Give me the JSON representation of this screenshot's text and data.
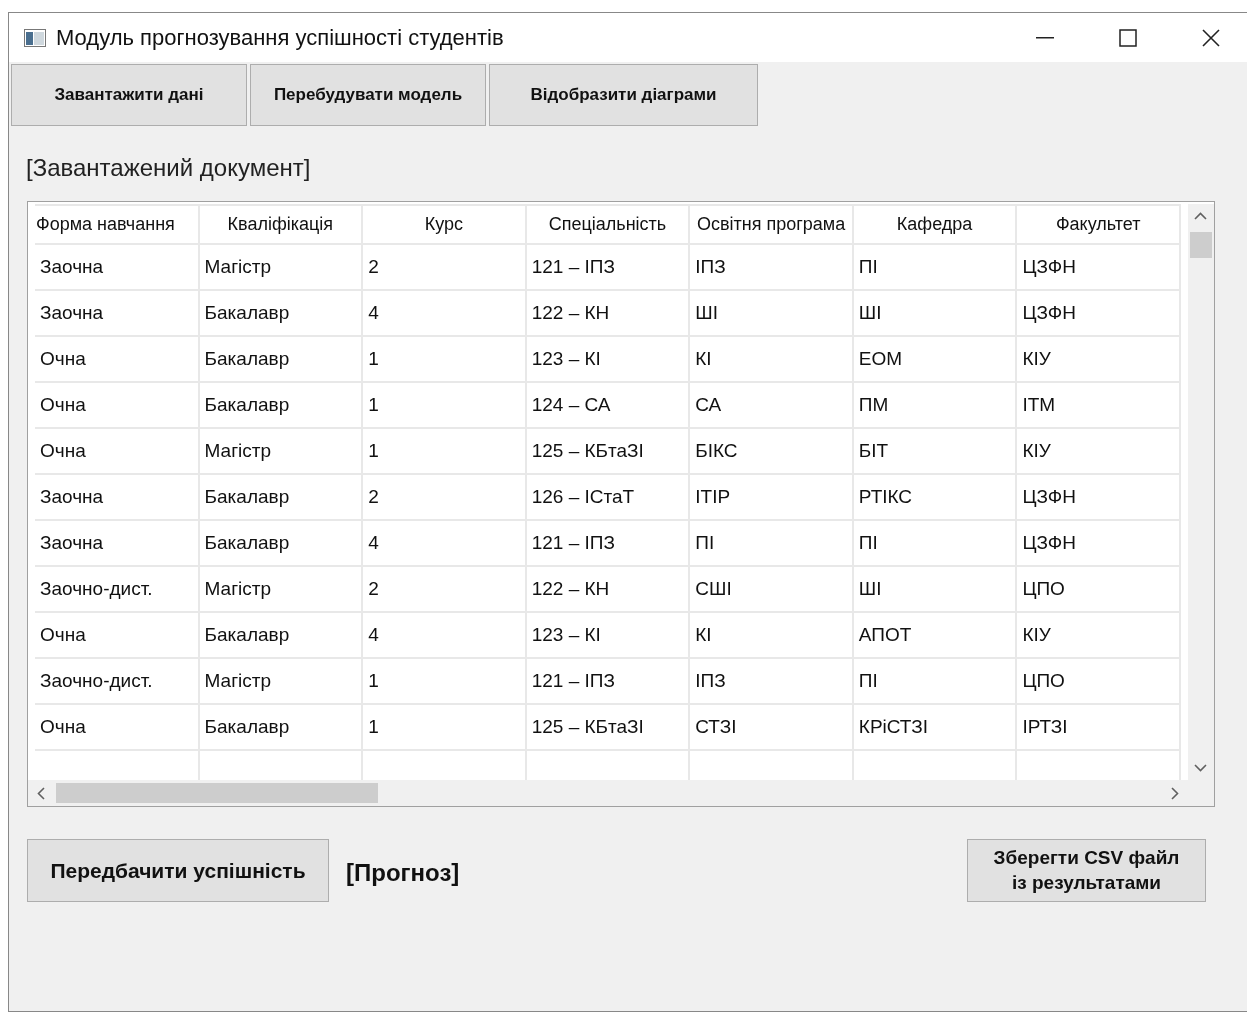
{
  "window": {
    "title": "Модуль прогнозування успішності студентів"
  },
  "toolbar": [
    "Завантажити дані",
    "Перебудувати модель",
    "Відобразити діаграми"
  ],
  "document_label": "[Завантажений документ]",
  "table": {
    "columns": [
      "Форма навчання",
      "Кваліфікація",
      "Курс",
      "Спеціальність",
      "Освітня програма",
      "Кафедра",
      "Факультет"
    ],
    "rows": [
      [
        "Заочна",
        "Магістр",
        "2",
        "121 – ІПЗ",
        "ІПЗ",
        "ПІ",
        "ЦЗФН"
      ],
      [
        "Заочна",
        "Бакалавр",
        "4",
        "122 – КН",
        "ШІ",
        "ШІ",
        "ЦЗФН"
      ],
      [
        "Очна",
        "Бакалавр",
        "1",
        "123 – КІ",
        "КІ",
        "ЕОМ",
        "КІУ"
      ],
      [
        "Очна",
        "Бакалавр",
        "1",
        "124 – СА",
        "СА",
        "ПМ",
        "ІТМ"
      ],
      [
        "Очна",
        "Магістр",
        "1",
        "125 – КБтаЗІ",
        "БІКС",
        "БІТ",
        "КІУ"
      ],
      [
        "Заочна",
        "Бакалавр",
        "2",
        "126 – ІСтаТ",
        "ІТІР",
        "РТІКС",
        "ЦЗФН"
      ],
      [
        "Заочна",
        "Бакалавр",
        "4",
        "121 – ІПЗ",
        "ПІ",
        "ПІ",
        "ЦЗФН"
      ],
      [
        "Заочно-дист.",
        "Магістр",
        "2",
        "122 – КН",
        "СШІ",
        "ШІ",
        "ЦПО"
      ],
      [
        "Очна",
        "Бакалавр",
        "4",
        "123 – КІ",
        "КІ",
        "АПОТ",
        "КІУ"
      ],
      [
        "Заочно-дист.",
        "Магістр",
        "1",
        "121 – ІПЗ",
        "ІПЗ",
        "ПІ",
        "ЦПО"
      ],
      [
        "Очна",
        "Бакалавр",
        "1",
        "125 – КБтаЗІ",
        "СТЗІ",
        "КРіСТЗІ",
        "ІРТЗІ"
      ]
    ]
  },
  "predict_button": "Передбачити успішність",
  "forecast_label": "[Прогноз]",
  "save_button": "Зберегти CSV файл із результатами"
}
